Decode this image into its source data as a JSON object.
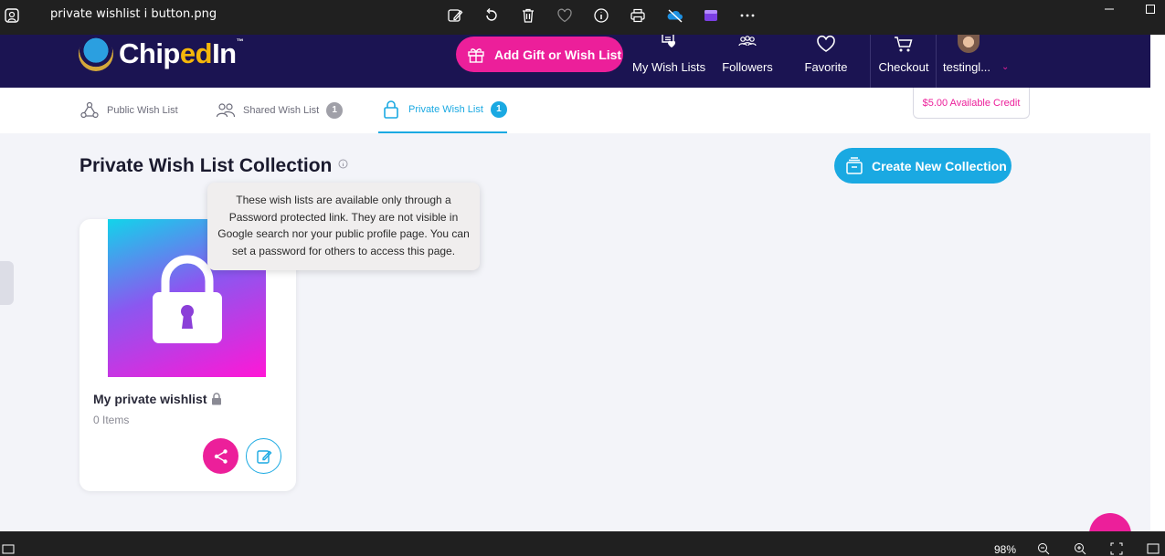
{
  "viewer": {
    "title": "private wishlist i button.png",
    "toolbar_icons": [
      "edit-image-icon",
      "rotate-icon",
      "delete-icon",
      "favorite-heart-icon",
      "info-icon",
      "print-icon",
      "onedrive-icon",
      "clipchamp-icon",
      "more-icon"
    ],
    "zoom": "98%"
  },
  "nav": {
    "logo_text_a": "Chip",
    "logo_text_b": "ed",
    "logo_text_c": "In",
    "logo_tm": "™",
    "add_button": "Add Gift or Wish List",
    "items": [
      {
        "label": "My Wish Lists",
        "icon": "wishlist-icon"
      },
      {
        "label": "Followers",
        "icon": "followers-icon"
      },
      {
        "label": "Favorite",
        "icon": "heart-icon"
      },
      {
        "label": "Checkout",
        "icon": "cart-icon"
      }
    ],
    "user": "testingl...",
    "caret": "⌄"
  },
  "tabs": [
    {
      "label": "Public Wish List",
      "badge": null
    },
    {
      "label": "Shared Wish List",
      "badge": "1"
    },
    {
      "label": "Private Wish List",
      "badge": "1"
    }
  ],
  "credit": "$5.00 Available Credit",
  "heading": "Private Wish List Collection",
  "create_button": "Create New Collection",
  "tooltip": "These wish lists are available only through a Password protected link. They are not visible in Google search nor your public profile page. You can set a password for others to access this page.",
  "card": {
    "title": "My private wishlist",
    "items": "0 Items"
  },
  "colors": {
    "nav_bg": "#1b1452",
    "pink": "#ec1f9a",
    "blue": "#1aa9e2"
  }
}
